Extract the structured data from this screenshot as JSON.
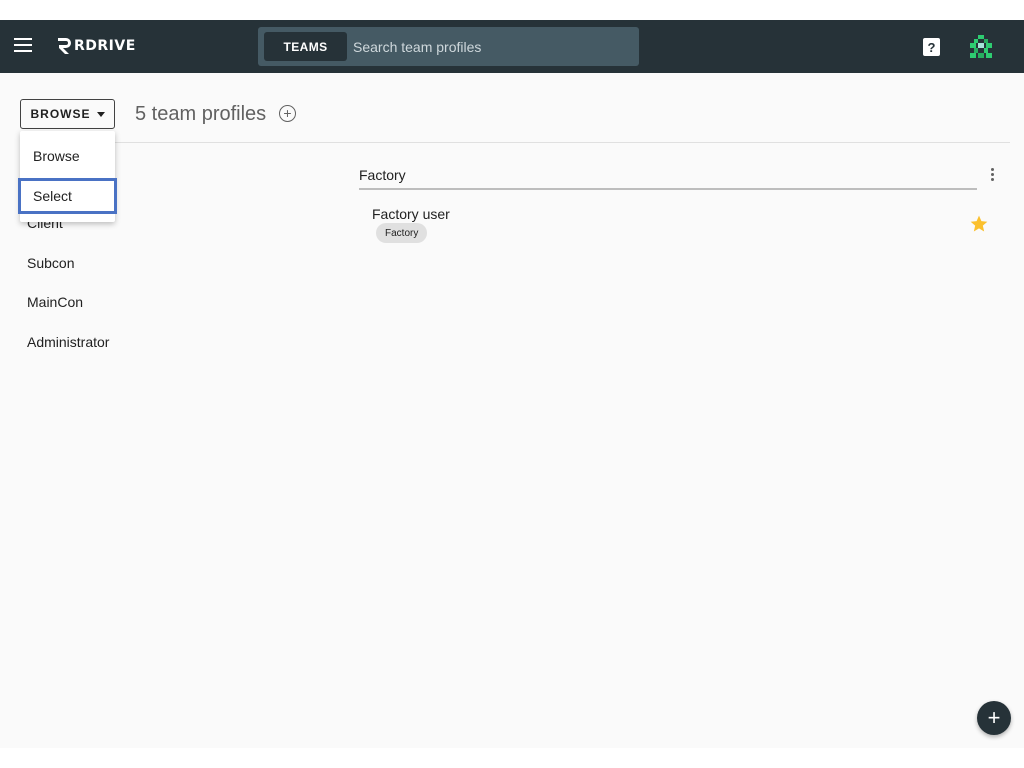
{
  "header": {
    "brand": "RDRIVE",
    "search_scope": "TEAMS",
    "search_placeholder": "Search team profiles",
    "help_symbol": "?"
  },
  "toolbar": {
    "view_mode": "BROWSE",
    "title": "5 team profiles",
    "add_symbol": "+"
  },
  "view_menu": {
    "items": [
      {
        "label": "Browse"
      },
      {
        "label": "Select",
        "highlighted": true
      }
    ]
  },
  "sidebar": {
    "items": [
      {
        "label": "Client"
      },
      {
        "label": "Subcon"
      },
      {
        "label": "MainCon"
      },
      {
        "label": "Administrator"
      }
    ]
  },
  "main": {
    "group_name": "Factory",
    "profiles": [
      {
        "name": "Factory user",
        "tag": "Factory",
        "starred": true
      }
    ]
  },
  "fab": {
    "symbol": "+"
  },
  "colors": {
    "header_bg": "#263238",
    "search_bg": "#455a64",
    "star": "#fbc02d",
    "highlight_border": "#4a72c4"
  }
}
